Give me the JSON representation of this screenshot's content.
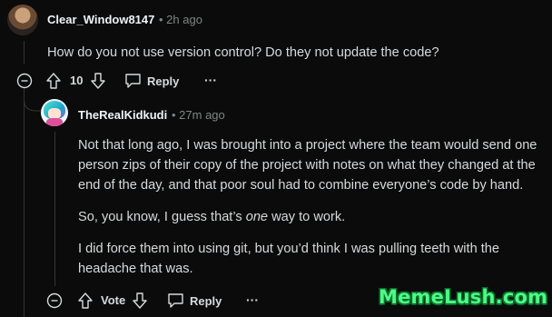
{
  "comment1": {
    "username": "Clear_Window8147",
    "timestamp": "• 2h ago",
    "body": "How do you not use version control? Do they not update the code?",
    "votes": "10",
    "reply_label": "Reply",
    "more_label": "···"
  },
  "comment2": {
    "username": "TheRealKidkudi",
    "timestamp": "• 27m ago",
    "paragraphs": {
      "p1": "Not that long ago, I was brought into a project where the team would send one person zips of their copy of the project with notes on what they changed at the end of the day, and that poor soul had to combine everyone’s code by hand.",
      "p2_before": "So, you know, I guess that’s ",
      "p2_em": "one",
      "p2_after": " way to work.",
      "p3": "I did force them into using git, but you’d think I was pulling teeth with the headache that was."
    },
    "vote_label": "Vote",
    "reply_label": "Reply",
    "more_label": "···"
  },
  "watermark": "MemeLush.com"
}
